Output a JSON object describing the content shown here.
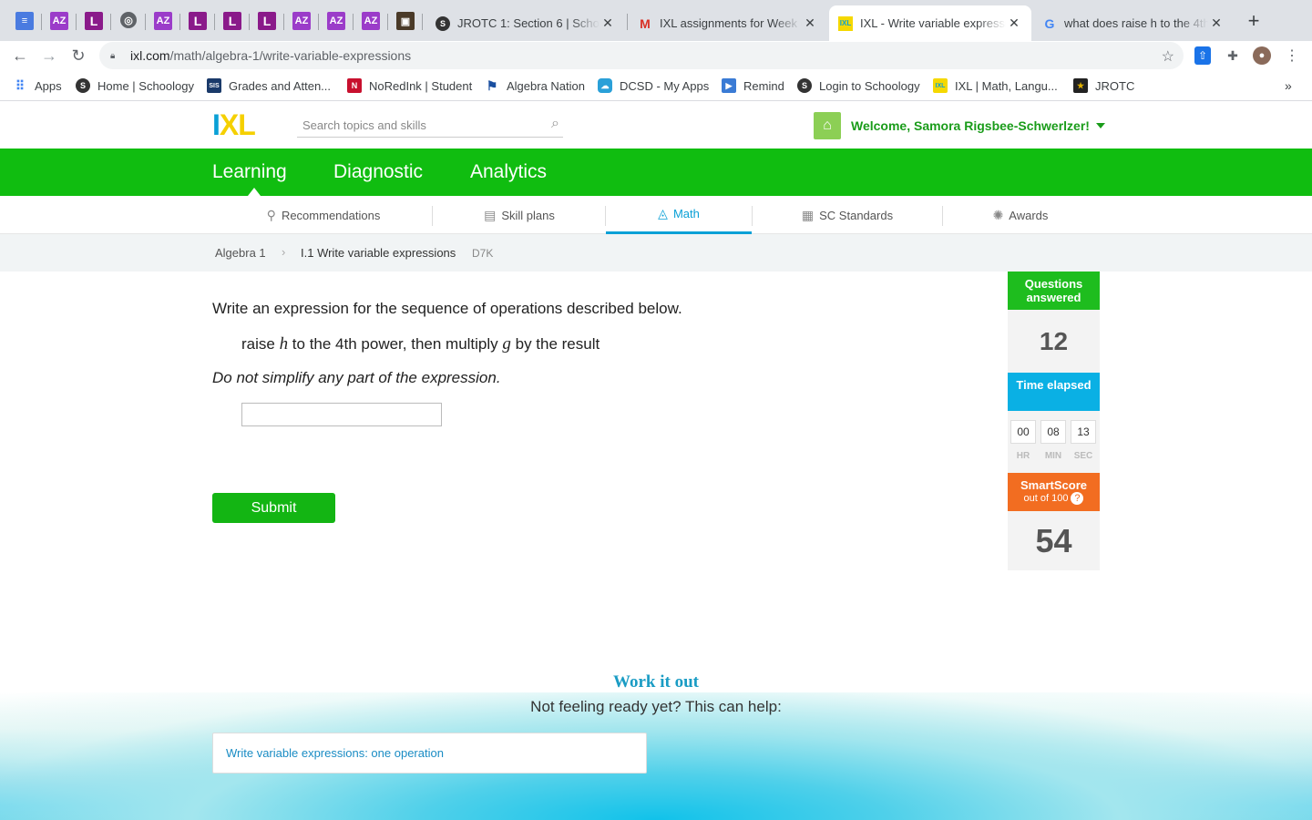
{
  "browser": {
    "tabs": [
      {
        "title": "JROTC 1: Section 6 | Schoology",
        "icon": "schoology-icon"
      },
      {
        "title": "IXL assignments for Week of",
        "icon": "gmail-icon"
      },
      {
        "title": "IXL - Write variable expressions",
        "icon": "ixl-icon",
        "active": true
      },
      {
        "title": "what does raise h to the 4th",
        "icon": "google-icon"
      }
    ],
    "url_host": "ixl.com",
    "url_path": "/math/algebra-1/write-variable-expressions",
    "bookmarks": [
      {
        "label": "Apps"
      },
      {
        "label": "Home | Schoology"
      },
      {
        "label": "Grades and Atten..."
      },
      {
        "label": "NoRedInk | Student"
      },
      {
        "label": "Algebra Nation"
      },
      {
        "label": "DCSD - My Apps"
      },
      {
        "label": "Remind"
      },
      {
        "label": "Login to Schoology"
      },
      {
        "label": "IXL | Math, Langu..."
      },
      {
        "label": "JROTC"
      }
    ]
  },
  "ixl": {
    "logo": "IXL",
    "search_placeholder": "Search topics and skills",
    "welcome": "Welcome, Samora Rigsbee-Schwerlzer!",
    "main_nav": [
      "Learning",
      "Diagnostic",
      "Analytics"
    ],
    "sub_nav": [
      {
        "label": "Recommendations"
      },
      {
        "label": "Skill plans"
      },
      {
        "label": "Math",
        "active": true
      },
      {
        "label": "SC Standards"
      },
      {
        "label": "Awards"
      }
    ],
    "breadcrumb": {
      "course": "Algebra 1",
      "skill": "I.1 Write variable expressions",
      "code": "D7K"
    }
  },
  "question": {
    "prompt": "Write an expression for the sequence of operations described below.",
    "text_pre": "raise ",
    "var1": "h",
    "text_mid": " to the 4th power, then multiply ",
    "var2": "g",
    "text_post": " by the result",
    "note": "Do not simplify any part of the expression.",
    "answer_value": "",
    "submit_label": "Submit"
  },
  "stats": {
    "questions_label": "Questions answered",
    "questions_count": "12",
    "time_label": "Time elapsed",
    "time": {
      "hr": "00",
      "min": "08",
      "sec": "13"
    },
    "time_units": {
      "hr": "HR",
      "min": "MIN",
      "sec": "SEC"
    },
    "smartscore_label": "SmartScore",
    "smartscore_sub": "out of 100",
    "smartscore_help": "?",
    "smartscore": "54"
  },
  "work_it_out": {
    "title": "Work it out",
    "subtitle": "Not feeling ready yet? This can help:",
    "link": "Write variable expressions: one operation"
  },
  "colors": {
    "ixl_green": "#10bd10",
    "ixl_blue": "#0ab0e4",
    "ixl_orange": "#f26d21"
  }
}
